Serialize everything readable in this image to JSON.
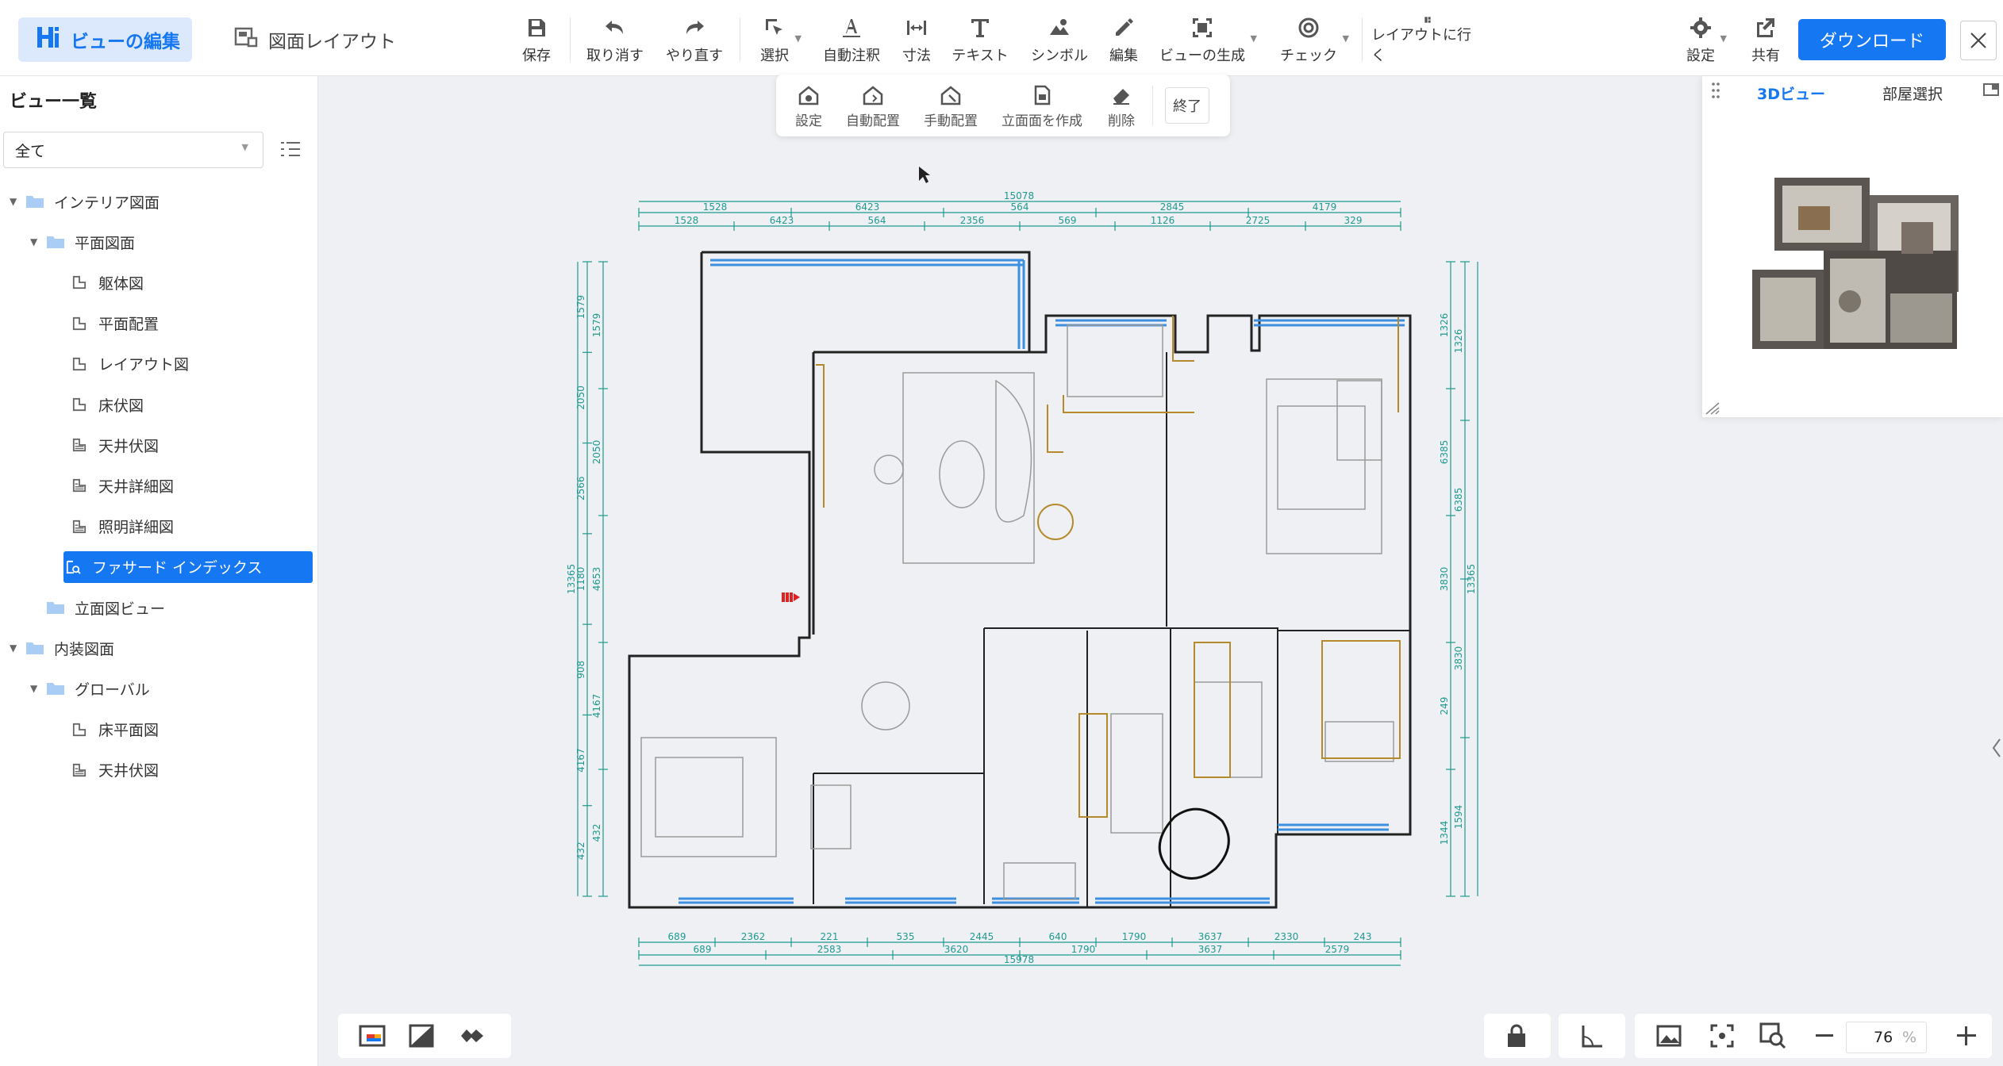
{
  "modes": {
    "active": "ビューの編集",
    "inactive": "図面レイアウト"
  },
  "toolbar": {
    "save": "保存",
    "undo": "取り消す",
    "redo": "やり直す",
    "select": "選択",
    "auto_annotate": "自動注釈",
    "dimension": "寸法",
    "text": "テキスト",
    "symbol": "シンボル",
    "edit": "編集",
    "generate_view": "ビューの生成",
    "check": "チェック",
    "goto_layout": "レイアウトに行く",
    "settings": "設定",
    "share": "共有",
    "download": "ダウンロード"
  },
  "sidebar": {
    "title": "ビュー一覧",
    "filter_value": "全て",
    "tree": [
      {
        "label": "インテリア図面",
        "level": 0,
        "type": "folder",
        "expanded": true
      },
      {
        "label": "平面図面",
        "level": 1,
        "type": "folder",
        "expanded": true
      },
      {
        "label": "躯体図",
        "level": 2,
        "type": "plan"
      },
      {
        "label": "平面配置",
        "level": 2,
        "type": "plan"
      },
      {
        "label": "レイアウト図",
        "level": 2,
        "type": "plan"
      },
      {
        "label": "床伏図",
        "level": 2,
        "type": "plan"
      },
      {
        "label": "天井伏図",
        "level": 2,
        "type": "ceiling"
      },
      {
        "label": "天井詳細図",
        "level": 2,
        "type": "ceiling"
      },
      {
        "label": "照明詳細図",
        "level": 2,
        "type": "ceiling"
      },
      {
        "label": "ファサード インデックス",
        "level": 2,
        "type": "facade",
        "selected": true
      },
      {
        "label": "立面図ビュー",
        "level": 1,
        "type": "folder"
      },
      {
        "label": "内装図面",
        "level": 0,
        "type": "folder",
        "expanded": true
      },
      {
        "label": "グローバル",
        "level": 1,
        "type": "folder",
        "expanded": true
      },
      {
        "label": "床平面図",
        "level": 2,
        "type": "plan"
      },
      {
        "label": "天井伏図",
        "level": 2,
        "type": "ceiling"
      }
    ]
  },
  "subtoolbar": {
    "settings": "設定",
    "auto_place": "自動配置",
    "manual_place": "手動配置",
    "create_elevation": "立面面を作成",
    "delete": "削除",
    "finish": "終了"
  },
  "panel3d": {
    "tab_3d": "3Dビュー",
    "tab_room": "部屋選択"
  },
  "zoom": {
    "value": "76",
    "unit": "%"
  },
  "colors": {
    "accent": "#1677f2",
    "dim": "#1f9a8f",
    "wall": "#222222",
    "window": "#3d8fe0",
    "gold": "#b48a2a"
  },
  "dims": {
    "top_total": "15078",
    "top1": [
      "1528",
      "6423",
      "564",
      "2845",
      "4179"
    ],
    "top2": [
      "1528",
      "6423",
      "564",
      "2356",
      "569",
      "1126",
      "2725",
      "329"
    ],
    "bottom1": [
      "689",
      "2362",
      "221",
      "535",
      "2445",
      "640",
      "1790",
      "3637",
      "2330",
      "243"
    ],
    "bottom2": [
      "689",
      "2583",
      "3620",
      "1790",
      "3637",
      "2579"
    ],
    "bottom_total": "15978",
    "left1": [
      "1579",
      "2050",
      "2566",
      "1180",
      "908",
      "4167",
      "432"
    ],
    "left2": [
      "1579",
      "2050",
      "4653",
      "4167",
      "432"
    ],
    "left_total": "13365",
    "right1": [
      "1326",
      "6385",
      "3830",
      "249",
      "1344"
    ],
    "right2": [
      "1326",
      "6385",
      "3830",
      "1594"
    ],
    "right_total": "13365"
  }
}
